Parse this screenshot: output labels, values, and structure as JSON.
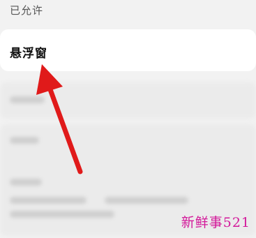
{
  "section": {
    "header": "已允许"
  },
  "highlighted_item": {
    "label": "悬浮窗"
  },
  "annotation": {
    "arrow_color": "#e01a1a",
    "icon": "red-pointer-arrow-icon"
  },
  "watermark": {
    "text": "新鲜事521",
    "color": "#d3189a"
  },
  "colors": {
    "background": "#f2f2f2",
    "card": "#ffffff"
  }
}
